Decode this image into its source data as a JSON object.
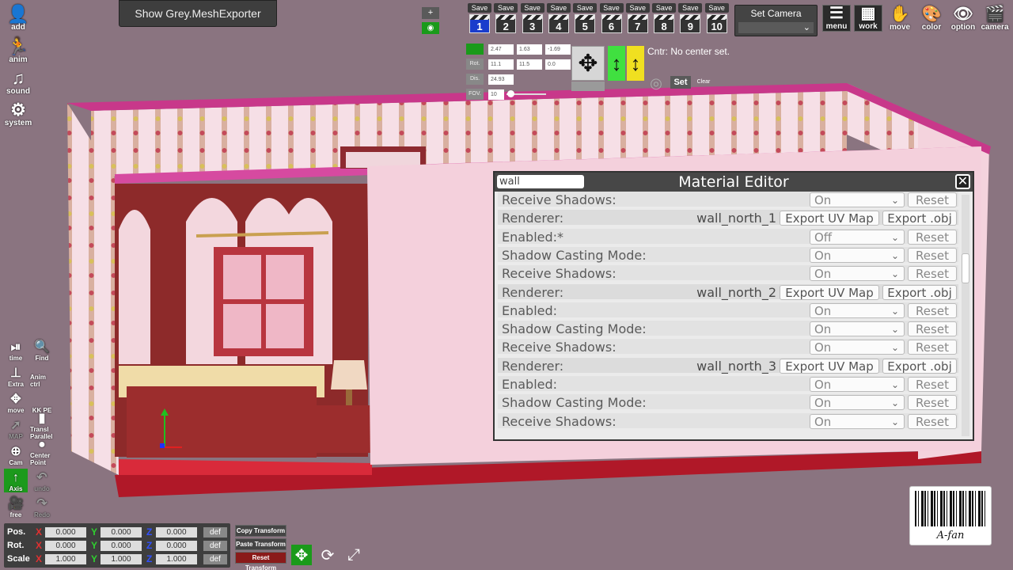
{
  "top": {
    "exporter_label": "Show Grey.MeshExporter",
    "zoom_plus": "+",
    "save_label": "Save",
    "slots": [
      "1",
      "2",
      "3",
      "4",
      "5",
      "6",
      "7",
      "8",
      "9",
      "10"
    ],
    "set_camera_label": "Set Camera",
    "tools": [
      {
        "label": "menu",
        "icon": "menu-icon",
        "glyph": "☰"
      },
      {
        "label": "work",
        "icon": "work-icon",
        "glyph": "▦"
      },
      {
        "label": "move",
        "icon": "hand-icon",
        "glyph": "✋"
      },
      {
        "label": "color",
        "icon": "palette-icon",
        "glyph": "🎨"
      },
      {
        "label": "option",
        "icon": "eye-icon",
        "glyph": "👁"
      },
      {
        "label": "camera",
        "icon": "camera-icon",
        "glyph": "🎬"
      }
    ]
  },
  "left_menu": [
    {
      "label": "add",
      "icon": "add-person-icon",
      "glyph": "👤"
    },
    {
      "label": "anim",
      "icon": "run-icon",
      "glyph": "🏃"
    },
    {
      "label": "sound",
      "icon": "music-icon",
      "glyph": "♫"
    },
    {
      "label": "system",
      "icon": "gears-icon",
      "glyph": "⚙"
    }
  ],
  "left_tools": [
    {
      "label": "time",
      "icon": "play-pause-icon",
      "glyph": "⏯",
      "dim": false,
      "green": false
    },
    {
      "label": "Find",
      "icon": "find-icon",
      "glyph": "🔍",
      "dim": false,
      "green": false
    },
    {
      "label": "Extra",
      "icon": "extra-icon",
      "glyph": "⊥",
      "dim": false,
      "green": false
    },
    {
      "label": "Anim ctrl",
      "icon": "anim-ctrl-icon",
      "glyph": "",
      "dim": false,
      "green": false
    },
    {
      "label": "move",
      "icon": "move-arrows-icon",
      "glyph": "✥",
      "dim": false,
      "green": false
    },
    {
      "label": "KK PE",
      "icon": "kkpe-icon",
      "glyph": "",
      "dim": false,
      "green": false
    },
    {
      "label": "MAP",
      "icon": "map-icon",
      "glyph": "➚",
      "dim": true,
      "green": false
    },
    {
      "label": "Transl Parallel",
      "icon": "transl-parallel-icon",
      "glyph": "▮",
      "dim": false,
      "green": false
    },
    {
      "label": "Cam",
      "icon": "cam-add-icon",
      "glyph": "⊕",
      "dim": false,
      "green": false
    },
    {
      "label": "Center Point",
      "icon": "center-point-icon",
      "glyph": "●",
      "dim": false,
      "green": false
    },
    {
      "label": "Axis",
      "icon": "axis-icon",
      "glyph": "↑",
      "dim": false,
      "green": true
    },
    {
      "label": "undo",
      "icon": "undo-icon",
      "glyph": "↶",
      "dim": true,
      "green": false
    },
    {
      "label": "free",
      "icon": "free-camera-icon",
      "glyph": "🎥",
      "dim": false,
      "green": false
    },
    {
      "label": "Redo",
      "icon": "redo-icon",
      "glyph": "↷",
      "dim": true,
      "green": false
    }
  ],
  "camera": {
    "pos": [
      "2.47",
      "1.63",
      "-1.69"
    ],
    "rot_label": "Rot.",
    "rot": [
      "11.1",
      "11.5",
      "0.0"
    ],
    "dis_label": "Dis.",
    "dis": "24.93",
    "fov_label": "FOV.",
    "fov": "10",
    "center_status": "Cntr: No center set.",
    "set_label": "Set",
    "clear_label": "Clear"
  },
  "material_editor": {
    "title": "Material Editor",
    "search_value": "wall",
    "rows": [
      {
        "type": "prop",
        "label": "Receive Shadows:",
        "value": "On"
      },
      {
        "type": "renderer",
        "label": "Renderer:",
        "name": "wall_north_1"
      },
      {
        "type": "prop",
        "label": "Enabled:*",
        "value": "Off"
      },
      {
        "type": "prop",
        "label": "Shadow Casting Mode:",
        "value": "On"
      },
      {
        "type": "prop",
        "label": "Receive Shadows:",
        "value": "On"
      },
      {
        "type": "renderer",
        "label": "Renderer:",
        "name": "wall_north_2"
      },
      {
        "type": "prop",
        "label": "Enabled:",
        "value": "On"
      },
      {
        "type": "prop",
        "label": "Shadow Casting Mode:",
        "value": "On"
      },
      {
        "type": "prop",
        "label": "Receive Shadows:",
        "value": "On"
      },
      {
        "type": "renderer",
        "label": "Renderer:",
        "name": "wall_north_3"
      },
      {
        "type": "prop",
        "label": "Enabled:",
        "value": "On"
      },
      {
        "type": "prop",
        "label": "Shadow Casting Mode:",
        "value": "On"
      },
      {
        "type": "prop",
        "label": "Receive Shadows:",
        "value": "On"
      }
    ],
    "reset_label": "Reset",
    "export_uv_label": "Export UV Map",
    "export_obj_label": "Export .obj"
  },
  "transform": {
    "rows": [
      {
        "label": "Pos.",
        "x": "0.000",
        "y": "0.000",
        "z": "0.000"
      },
      {
        "label": "Rot.",
        "x": "0.000",
        "y": "0.000",
        "z": "0.000"
      },
      {
        "label": "Scale",
        "x": "1.000",
        "y": "1.000",
        "z": "1.000"
      }
    ],
    "def_label": "def",
    "copy_label": "Copy Transform",
    "paste_label": "Paste Transform",
    "reset_label": "Reset Transform"
  },
  "barcode_caption": "A-fan"
}
